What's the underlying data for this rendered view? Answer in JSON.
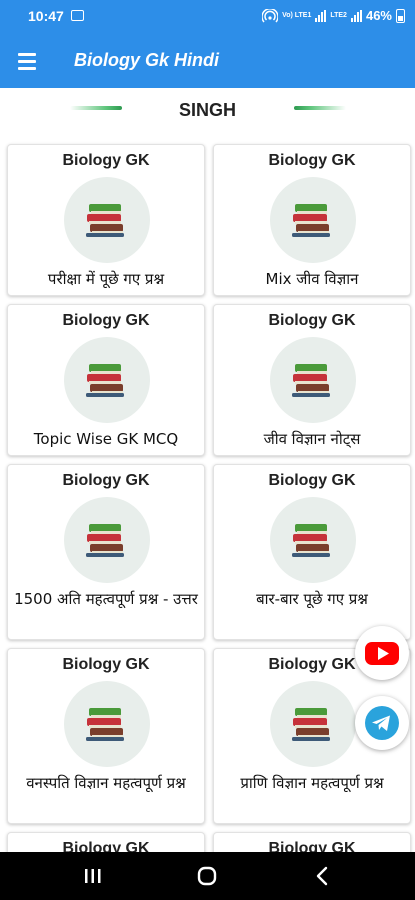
{
  "status_bar": {
    "time": "10:47",
    "battery": "46%",
    "network_top": "Vo) LTE1",
    "network_bottom": "LTE2"
  },
  "app_bar": {
    "title": "Biology Gk Hindi"
  },
  "banner": {
    "text": "SINGH"
  },
  "cards": [
    {
      "heading": "Biology GK",
      "label": "परीक्षा में पूछे गए प्रश्न"
    },
    {
      "heading": "Biology GK",
      "label": "Mix जीव विज्ञान"
    },
    {
      "heading": "Biology GK",
      "label": "Topic Wise GK MCQ"
    },
    {
      "heading": "Biology GK",
      "label": "जीव विज्ञान नोट्स"
    },
    {
      "heading": "Biology GK",
      "label": "1500 अति महत्वपूर्ण प्रश्न - उत्तर"
    },
    {
      "heading": "Biology GK",
      "label": "बार-बार पूछे गए प्रश्न"
    },
    {
      "heading": "Biology GK",
      "label": "वनस्पति विज्ञान महत्वपूर्ण प्रश्न"
    },
    {
      "heading": "Biology GK",
      "label": "प्राणि विज्ञान महत्वपूर्ण प्रश्न"
    },
    {
      "heading": "Biology GK",
      "label": ""
    },
    {
      "heading": "Biology GK",
      "label": ""
    }
  ],
  "floating_buttons": {
    "youtube": "youtube-icon",
    "telegram": "telegram-icon"
  },
  "colors": {
    "primary": "#2d8ee8",
    "youtube": "#ff0000",
    "telegram": "#2aa3dc",
    "accent_line": "#3aa55c"
  }
}
